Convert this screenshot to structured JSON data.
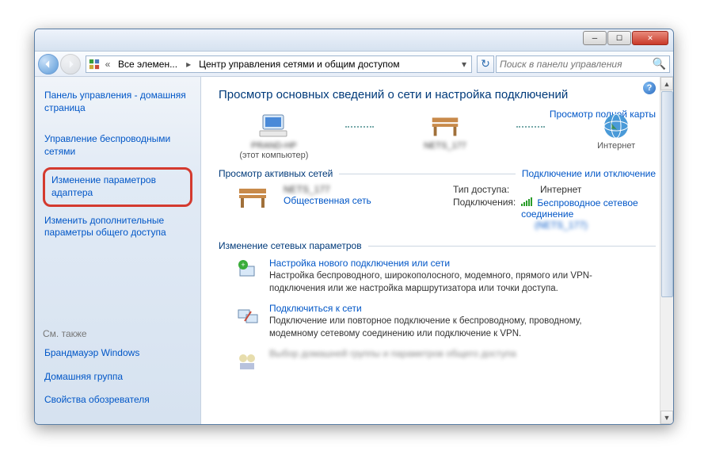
{
  "titlebar": {
    "minimize": "─",
    "maximize": "☐",
    "close": "✕"
  },
  "nav": {
    "breadcrumb_root": "Все элемен...",
    "breadcrumb_current": "Центр управления сетями и общим доступом",
    "search_placeholder": "Поиск в панели управления"
  },
  "sidebar": {
    "home": "Панель управления - домашняя страница",
    "wireless": "Управление беспроводными сетями",
    "adapter": "Изменение параметров адаптера",
    "sharing": "Изменить дополнительные параметры общего доступа",
    "seealso": "См. также",
    "firewall": "Брандмауэр Windows",
    "homegroup": "Домашняя группа",
    "ie": "Свойства обозревателя"
  },
  "main": {
    "heading": "Просмотр основных сведений о сети и настройка подключений",
    "fullmap": "Просмотр полной карты",
    "node_pc": "PRAND-HP",
    "node_pc_sub": "(этот компьютер)",
    "node_net": "NETS_177",
    "node_inet": "Интернет",
    "active_title": "Просмотр активных сетей",
    "active_link": "Подключение или отключение",
    "net_name": "NETS_177",
    "net_public": "Общественная сеть",
    "access_k": "Тип доступа:",
    "access_v": "Интернет",
    "conn_k": "Подключения:",
    "conn_v": "Беспроводное сетевое соединение",
    "conn_sub": "(NETS_177)",
    "change_title": "Изменение сетевых параметров",
    "task1_t": "Настройка нового подключения или сети",
    "task1_d": "Настройка беспроводного, широкополосного, модемного, прямого или VPN-подключения или же настройка маршрутизатора или точки доступа.",
    "task2_t": "Подключиться к сети",
    "task2_d": "Подключение или повторное подключение к беспроводному, проводному, модемному сетевому соединению или подключение к VPN.",
    "task3_t": "Выбор домашней группы и параметров общего доступа"
  }
}
